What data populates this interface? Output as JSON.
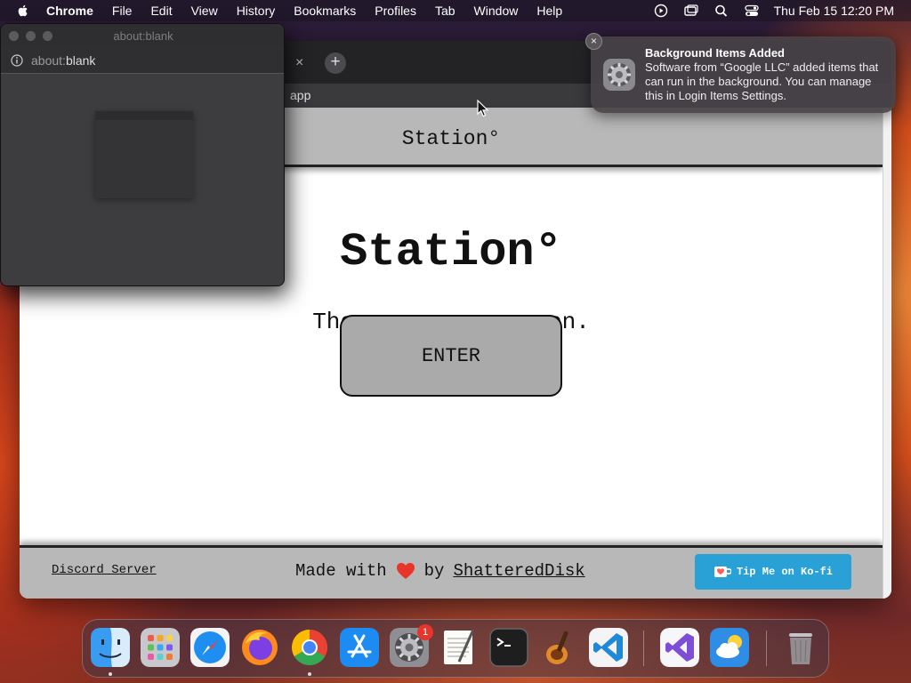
{
  "menubar": {
    "app_name": "Chrome",
    "items": [
      "File",
      "Edit",
      "View",
      "History",
      "Bookmarks",
      "Profiles",
      "Tab",
      "Window",
      "Help"
    ],
    "clock": "Thu Feb 15  12:20 PM"
  },
  "browser": {
    "tab_close": "×",
    "new_tab": "+",
    "address_fragment": "app"
  },
  "site": {
    "header_title": "Station°",
    "hero_title": "Station°",
    "tagline_left": "The",
    "tagline_right": "on.",
    "enter_label": "ENTER",
    "footer": {
      "discord_label": "Discord Server",
      "made_with_prefix": "Made with",
      "made_with_by": "by",
      "author": "ShatteredDisk",
      "kofi_label": "Tip Me on Ko-fi"
    }
  },
  "popup": {
    "title": "about:blank",
    "url_light": "about:",
    "url_strong": "blank"
  },
  "notification": {
    "title": "Background Items Added",
    "body": "Software from “Google LLC” added items that can run in the background. You can manage this in Login Items Settings.",
    "close": "×"
  },
  "dock": {
    "apps": [
      "Finder",
      "Launchpad",
      "Safari",
      "Firefox",
      "Google Chrome",
      "App Store",
      "System Settings",
      "TextEdit",
      "Terminal",
      "GarageBand",
      "Visual Studio Code",
      "Visual Studio",
      "Weather",
      "Trash"
    ],
    "settings_badge": "1"
  },
  "colors": {
    "kofi": "#2aa1d6",
    "site_chrome": "#b8b8b8",
    "badge": "#e8352c"
  }
}
